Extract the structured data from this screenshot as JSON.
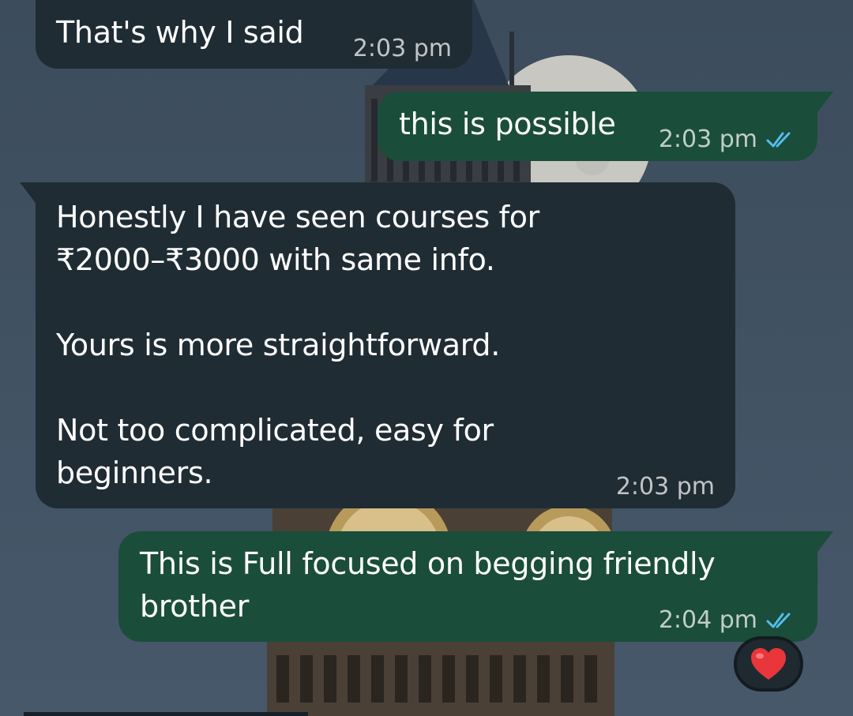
{
  "messages": [
    {
      "direction": "incoming",
      "text": "That's why I said",
      "time": "2:03 pm"
    },
    {
      "direction": "outgoing",
      "text": "this is possible",
      "time": "2:03 pm",
      "ticks": "read"
    },
    {
      "direction": "incoming",
      "text": "Honestly I have seen courses for\n₹2000–₹3000 with same info.\n\nYours is more straightforward.\n\nNot too complicated, easy for\nbeginners.",
      "time": "2:03 pm"
    },
    {
      "direction": "outgoing",
      "text": "This is Full focused on begging friendly\nbrother",
      "time": "2:04 pm",
      "ticks": "read",
      "reaction": "❤️"
    }
  ],
  "colors": {
    "incoming_bubble": "#202c33",
    "outgoing_bubble": "#1a4d3a",
    "read_ticks": "#53bdeb",
    "reaction_heart": "#e8363b"
  },
  "icons": {
    "read_receipt": "double-check-icon",
    "reaction": "heart-icon"
  }
}
